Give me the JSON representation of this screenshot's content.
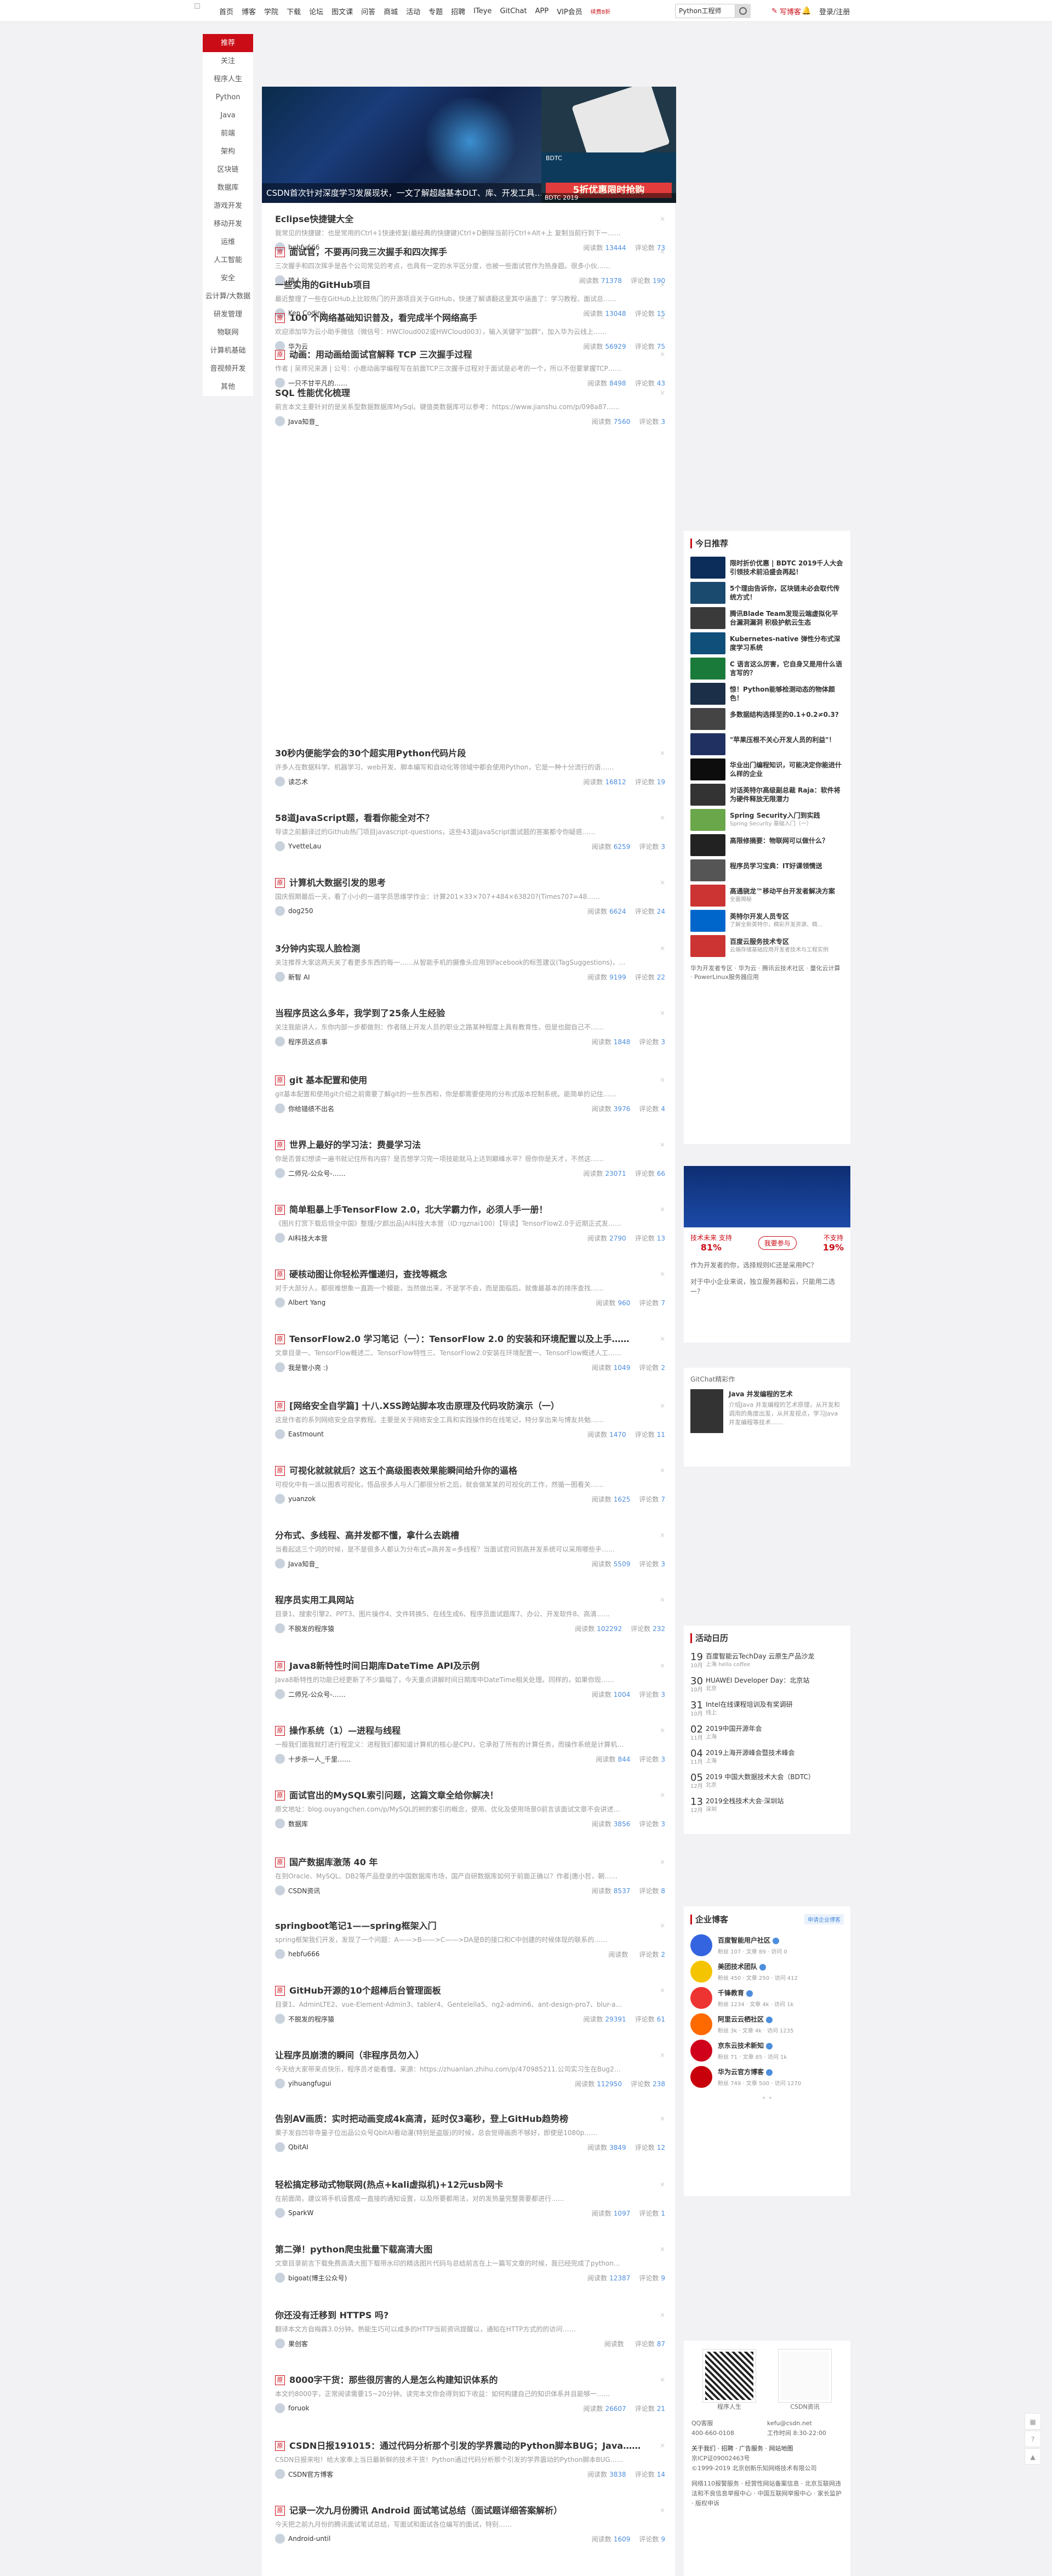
{
  "nav": [
    "首页",
    "博客",
    "学院",
    "下载",
    "论坛",
    "图文课",
    "问答",
    "商城",
    "活动",
    "专题",
    "招聘",
    "ITeye",
    "GitChat",
    "APP",
    "VIP会员"
  ],
  "vip_new": "续费8折",
  "search": {
    "value": "Python工程师"
  },
  "top_right": {
    "write": "写博客",
    "login": "登录/注册"
  },
  "leftnav": [
    "推荐",
    "关注",
    "程序人生",
    "Python",
    "Java",
    "前端",
    "架构",
    "区块链",
    "数据库",
    "游戏开发",
    "移动开发",
    "运维",
    "人工智能",
    "安全",
    "云计算/大数据",
    "研发管理",
    "物联网",
    "计算机基础",
    "音视频开发",
    "其他"
  ],
  "carousel": {
    "caption": "CSDN首次针对深度学习发展现状，一文了解超越基本DLT、库、开发工具……",
    "right_band": "BDTC",
    "right_hot": "5折优惠限时抢购",
    "right_caption": "BDTC 2019"
  },
  "articles": [
    {
      "title": "Eclipse快捷键大全",
      "summary": "我常见的快捷键：也是常用的Ctrl+1快速修复(最经典的快捷键)Ctrl+D删除当前行Ctrl+Alt+上 复制当前行到下一……",
      "author": "hebfu666",
      "reads": "13444",
      "comments": "73",
      "orig": false
    },
    {
      "title": "面试官，不要再问我三次握手和四次挥手",
      "summary": "三次握手和四次挥手是各个公司常见的考点，也具有一定的水平区分度，也被一些面试官作为热身题。很多小伙……",
      "author": "猿人谷",
      "reads": "71378",
      "comments": "190",
      "orig": true
    },
    {
      "title": "一些实用的GitHub项目",
      "summary": "最近整理了一些在GitHub上比较热门的开源项目关于GitHub，快速了解请翻这里其中涵盖了：学习教程、面试总……",
      "author": "Ken Coding",
      "reads": "13048",
      "comments": "15",
      "orig": false
    },
    {
      "title": "100 个网络基础知识普及，看完成半个网络高手",
      "summary": "欢迎添加华为云小助手微信（微信号：HWCloud002或HWCloud003），输入关键字\"加群\"，加入华为云线上……",
      "author": "华为云",
      "reads": "56929",
      "comments": "75",
      "orig": true
    },
    {
      "title": "动画：用动画给面试官解释 TCP 三次握手过程",
      "summary": "作者 | 吴师兄来源 | 公号：小鹿动画学编程写在前面TCP三次握手过程对于面试是必考的一个，所以不但要掌握TCP……",
      "author": "一只不甘平凡的……",
      "reads": "8498",
      "comments": "43",
      "orig": true
    },
    {
      "title": "SQL 性能优化梳理",
      "summary": "前言本文主要针对的是关系型数据数据库MySql。键值类数据库可以参考：https://www.jianshu.com/p/098a87……",
      "author": "Java知音_",
      "reads": "7560",
      "comments": "3",
      "orig": false
    },
    {
      "title": "30秒内便能学会的30个超实用Python代码片段",
      "summary": "许多人在数据科学、机器学习、web开发、脚本编写和自动化等领域中都会使用Python，它是一种十分流行的语……",
      "author": "读芯术",
      "reads": "16812",
      "comments": "19",
      "orig": false
    },
    {
      "title": "58道JavaScript题，看看你能全对不？",
      "summary": "导读之前翻译过的Github热门项目javascript-questions，这些43道JavaScript面试题的答案都令你疑惑……",
      "author": "YvetteLau",
      "reads": "6259",
      "comments": "3",
      "orig": false
    },
    {
      "title": "计算机大数据引发的思考",
      "summary": "国庆假期最后一天，看了小小的一道学员思维学作业：计算201×33×707+484×63820?(Times707=48……",
      "author": "dog250",
      "reads": "6624",
      "comments": "24",
      "orig": true
    },
    {
      "title": "3分钟内实现人脸检测",
      "summary": "关注推荐大家这两天关了看更多东西的每一……从智能手机的摄像头应用到Facebook的标签建议(TagSuggestions)，人……",
      "author": "新智 AI",
      "reads": "9199",
      "comments": "22",
      "orig": false
    },
    {
      "title": "当程序员这么多年，我学到了25条人生经验",
      "summary": "关注我能讲人，东你内部一步都做到：作者随上开发人员的职业之路某种程度上具有教育性，但是也甜自己不……",
      "author": "程序员这点事",
      "reads": "1848",
      "comments": "3",
      "orig": false
    },
    {
      "title": "git 基本配置和使用",
      "summary": "git基本配置和使用git介绍之前需要了解git的一些东西和，你是都需要使用的分布式版本控制系统。能简单的记住……",
      "author": "你给错绩不出名",
      "reads": "3976",
      "comments": "4",
      "orig": true
    },
    {
      "title": "世界上最好的学习法：费曼学习法",
      "summary": "你是否曾幻想读一遍书就记住所有内容？是否想学习完一项技能就马上达到巅峰水平？很你你是天才，不然这……",
      "author": "二师兄-公众号-……",
      "reads": "23071",
      "comments": "66",
      "orig": true
    },
    {
      "title": "简单粗暴上手TensorFlow 2.0，北大学霸力作，必须人手一册！",
      "summary": "《图片打赏下载后领全中国》整理/夕颜出品|AI科技大本营（ID:rgznai100）【导读】TensorFlow2.0于近期正式发……",
      "author": "AI科技大本营",
      "reads": "2790",
      "comments": "13",
      "orig": true
    },
    {
      "title": "硬核动图让你轻松弄懂递归，查找等概念",
      "summary": "对于大部分人，都很难想象一直跑一个模能，当然做出来，不是学不会，而是面临后。就像最基本的排序查找……",
      "author": "Albert Yang",
      "reads": "960",
      "comments": "7",
      "orig": true
    },
    {
      "title": "TensorFlow2.0 学习笔记（一）：TensorFlow 2.0 的安装和环境配置以及上手……",
      "summary": "文章目录一、TensorFlow概述二、TensorFlow特性三、TensorFlow2.0安装在环境配置一、TensorFlow概述人工……",
      "author": "我是管小亮 :)",
      "reads": "1049",
      "comments": "2",
      "orig": true
    },
    {
      "title": "[网络安全自学篇] 十八.XSS跨站脚本攻击原理及代码攻防演示（一）",
      "summary": "这是作者的系列网络安全自学教程。主要是关于网络安全工具和实践操作的在线笔记，特分享出来与博友共勉……",
      "author": "Eastmount",
      "reads": "1470",
      "comments": "11",
      "orig": true
    },
    {
      "title": "可视化就就就后？这五个高级图表效果能瞬间给升你的逼格",
      "summary": "可视化中有一派以图表可视化，悟品很多人与人门都很分析之后，就会做某某的可视化的工作，然循一图看关……",
      "author": "yuanzok",
      "reads": "1625",
      "comments": "7",
      "orig": true
    },
    {
      "title": "分布式、多线程、高并发都不懂，拿什么去跳槽",
      "summary": "当看起这三个词的时候，是不是很多人都认为分布式=高并发=多线程？当面试官问到高并发系统可以采用哪些手……",
      "author": "Java知音_",
      "reads": "5509",
      "comments": "3",
      "orig": false
    },
    {
      "title": "程序员实用工具网站",
      "summary": "目录1、搜索引擎2、PPT3、图片操作4、文件转换5、在线生成6、程序员面试题库7、办公、开发软件8、高清……",
      "author": "不脱发的程序猿",
      "reads": "102292",
      "comments": "232",
      "orig": false
    },
    {
      "title": "Java8新特性时间日期库DateTime API及示例",
      "summary": "Java8新特性的功能已经更新了不少篇幅了，今天重点讲解时间日期库中DateTime相关处理。同样的，如果你现……",
      "author": "二师兄-公众号-……",
      "reads": "1004",
      "comments": "3",
      "orig": true
    },
    {
      "title": "操作系统（1）—进程与线程",
      "summary": "一般我们面我就打进行程定义：进程我们都知道计算机的核心是CPU，它承担了所有的计算任务，而操作系统是计算机……",
      "author": "十步杀一人_千里……",
      "reads": "844",
      "comments": "3",
      "orig": true
    },
    {
      "title": "面试官出的MySQL索引问题，这篇文章全给你解决！",
      "summary": "原文地址：blog.ouyangchen.com/p/MySQL的树的索引的概念，使用、优化及使用场景0前言该面试文章不会讲述数据……",
      "author": "数据库",
      "reads": "3856",
      "comments": "3",
      "orig": true
    },
    {
      "title": "国产数据库激荡 40 年",
      "summary": "在到Oracle、MySQL、DB2等产品登录的中国数据库市场，国产自研数据库如何于前面正确以？作者|唐小哲，朝……",
      "author": "CSDN资讯",
      "reads": "8537",
      "comments": "8",
      "orig": true
    },
    {
      "title": "springboot笔记1——spring框架入门",
      "summary": "spring框架我们开发，发现了一个问题：A——>B——>C——>DA是B的接口和C中创建的时候体现的联系的……",
      "author": "hebfu666",
      "reads": "",
      "comments": "2",
      "orig": false
    },
    {
      "title": "GitHub开源的10个超棒后台管理面板",
      "summary": "目录1、AdminLTE2、vue-Element-Admin3、tabler4、Gentelella5、ng2-admin6、ant-design-pro7、blur-a……",
      "author": "不脱发的程序猿",
      "reads": "29391",
      "comments": "61",
      "orig": true
    },
    {
      "title": "让程序员崩溃的瞬间（非程序员勿入）",
      "summary": "今天给大家带来点快乐，程序员才能看懂。来源：https://zhuanlan.zhihu.com/p/470985211.公司实习生在Bug2……",
      "author": "yihuangfugui",
      "reads": "112950",
      "comments": "238",
      "orig": false
    },
    {
      "title": "告别AV画质：实时把动画变成4k高清，延时仅3毫秒，登上GitHub趋势榜",
      "summary": "栗子发自凹非寺量子位出品公众号QbitAI看动漫(特别是盗版)的时候，总会觉得画质不够好，即使是1080p……",
      "author": "QbitAI",
      "reads": "3849",
      "comments": "12",
      "orig": false
    },
    {
      "title": "轻松搞定移动式物联网(热点+kali虚拟机)+12元usb网卡",
      "summary": "在前面简，建议将手机设置成一直接的通知设置，以及所要都用法，对的发热量完整需要都进行……",
      "author": "SparkW",
      "reads": "1097",
      "comments": "1",
      "orig": false
    },
    {
      "title": "第二弹！python爬虫批量下载高清大图",
      "summary": "文章目录前言下载免费高清大图下载带水印的精选图片代码与总结前言在上一篇写文章的时候，我已经完成了python……",
      "author": "bigoat(博主公众号)",
      "reads": "12387",
      "comments": "9",
      "orig": false
    },
    {
      "title": "你还没有迁移到 HTTPS 吗?",
      "summary": "翻译本文方自梅霖3.0分钟。熟能生巧可以成多的HTTP当前资讯提醒以，通知在HTTP方式的的访问……",
      "author": "果创客",
      "reads": "",
      "comments": "87",
      "orig": false
    },
    {
      "title": "8000字干货：那些很厉害的人是怎么构建知识体系的",
      "summary": "本文约8000字，正常阅读需要15~20分钟。读完本文你会得到如下收益：如何构建自己的知识体系并且能够一……",
      "author": "foruok",
      "reads": "26607",
      "comments": "21",
      "orig": true
    },
    {
      "title": "CSDN日报191015：通过代码分析那个引发的学界震动的Python脚本BUG；Java……",
      "summary": "CSDN日报来啦！给大家奉上当日最新鲜的技术干货！Python通过代码分析那个引发的学界震动的Python脚本BUG……",
      "author": "CSDN官方博客",
      "reads": "3838",
      "comments": "14",
      "orig": true
    },
    {
      "title": "记录一次九月份腾讯 Android 面试笔试总结（面试题详细答案解析）",
      "summary": "今天把之前九月份的腾讯面试笔试总结，写面试和面试各位编写的面试，特别……",
      "author": "Android-until",
      "reads": "1609",
      "comments": "9",
      "orig": true
    }
  ],
  "right_hot": {
    "title": "今日推荐",
    "items": [
      {
        "text": "限时折价优惠 | BDTC 2019千人大会引领技术前沿盛会再起！",
        "sub": ""
      },
      {
        "text": "5个理由告诉你，区块链未必会取代传统方式！",
        "sub": ""
      },
      {
        "text": "腾讯Blade Team发现云端虚拟化平台漏洞漏洞 积极护航云生态",
        "sub": ""
      },
      {
        "text": "Kubernetes-native 弹性分布式深度学习系统",
        "sub": ""
      },
      {
        "text": "C 语言这么厉害，它自身又是用什么语言写的？",
        "sub": ""
      },
      {
        "text": "惊！Python能够检测动态的物体颜色！",
        "sub": ""
      },
      {
        "text": "多数据结构选择至的0.1+0.2≠0.3?",
        "sub": ""
      },
      {
        "text": "\"苹果压根不关心开发人员的利益\"！",
        "sub": ""
      },
      {
        "text": "华业出门编程知识，可能决定你能进什么样的企业",
        "sub": ""
      },
      {
        "text": "对话英特尔高级副总裁 Raja：软件将为硬件释放无限潜力",
        "sub": ""
      },
      {
        "text": "Spring Security入门到实践",
        "sub": "Spring Security 基础入门（一）"
      },
      {
        "text": "高限修摘要：物联网可以做什么？",
        "sub": ""
      },
      {
        "text": "程序员学习宝典：IT好课领情送",
        "sub": ""
      },
      {
        "text": "高通骁龙™移动平台开发者解决方案",
        "sub": "全面揭秘"
      },
      {
        "text": "英特尔开发人员专区",
        "sub": "了解全新英特尔，精彩开发资源、精…"
      },
      {
        "text": "百度云服务技术专区",
        "sub": "云端存储基础应用开发者技术与工程实例"
      }
    ],
    "links": "华为开发者专区 · 华为云 · 腾讯云技术社区 · 量化云计算 · PowerLinux服务器应用"
  },
  "poll": {
    "title": "技术未来 支持",
    "yes_pct": "81%",
    "no_pct": "19%",
    "btn": "我要参与",
    "no_label": "不支持",
    "q1": "作为开发者的你，选择规则IC还是采用PC？",
    "q2": "对于中小企业来说，独立服务器和云，只能用二选一？"
  },
  "gitchat": {
    "title": "GitChat精彩作",
    "name": "Java 并发编程的艺术",
    "desc": "介绍Java 并发编程的艺术原理，从开发和调用的角度出发，从并发视点，学习Java并发编程等技术……"
  },
  "events": {
    "title": "活动日历",
    "items": [
      {
        "day": "19",
        "mon": "10月",
        "name": "百度智能云TechDay 云原生产品沙龙",
        "loc": "上海 hello coffee"
      },
      {
        "day": "30",
        "mon": "10月",
        "name": "HUAWEI Developer Day：北京站",
        "loc": "北京"
      },
      {
        "day": "31",
        "mon": "10月",
        "name": "Intel在线课程培训及有奖调研",
        "loc": "线上"
      },
      {
        "day": "02",
        "mon": "11月",
        "name": "2019中国开源年会",
        "loc": "上海"
      },
      {
        "day": "04",
        "mon": "11月",
        "name": "2019上海开源峰会暨技术峰会",
        "loc": "上海"
      },
      {
        "day": "05",
        "mon": "12月",
        "name": "2019 中国大数据技术大会（BDTC）",
        "loc": "北京"
      },
      {
        "day": "13",
        "mon": "12月",
        "name": "2019全栈技术大会·深圳站",
        "loc": "深圳"
      }
    ]
  },
  "enterprise": {
    "title": "企业博客",
    "join": "申请企业博客",
    "items": [
      {
        "name": "百度智能用户社区",
        "stat": "粉丝 107  · 文章 89  · 访问 0"
      },
      {
        "name": "美团技术团队",
        "stat": "粉丝 450  · 文章 250  · 访问 412"
      },
      {
        "name": "千锋教育",
        "stat": "粉丝 1234  · 文章 4k  · 访问 1k"
      },
      {
        "name": "阿里云云栖社区",
        "stat": "粉丝 3k  · 文章 4k  · 访问 1235"
      },
      {
        "name": "京东云技术新知",
        "stat": "粉丝 71  · 文章 85  · 访问 1k"
      },
      {
        "name": "华为云官方博客",
        "stat": "粉丝 749  · 文章 500  · 访问 1270"
      }
    ]
  },
  "footer_right": {
    "qr_label": "程序人生",
    "qr_label2": "CSDN资讯",
    "qq": "QQ客服",
    "email": "kefu@csdn.net",
    "tel": "400-660-0108",
    "hours": "工作时间 8:30-22:00",
    "about": "关于我们 · 招聘 · 广告服务 · 网站地图",
    "icp": "京ICP证09002463号",
    "copyright": "©1999-2019 北京创新乐知网络技术有限公司",
    "misc": "网络110报警服务 · 经营性网站备案信息 · 北京互联网违法和不良信息举报中心 · 中国互联网举报中心 · 家长监护 · 版权申诉"
  }
}
